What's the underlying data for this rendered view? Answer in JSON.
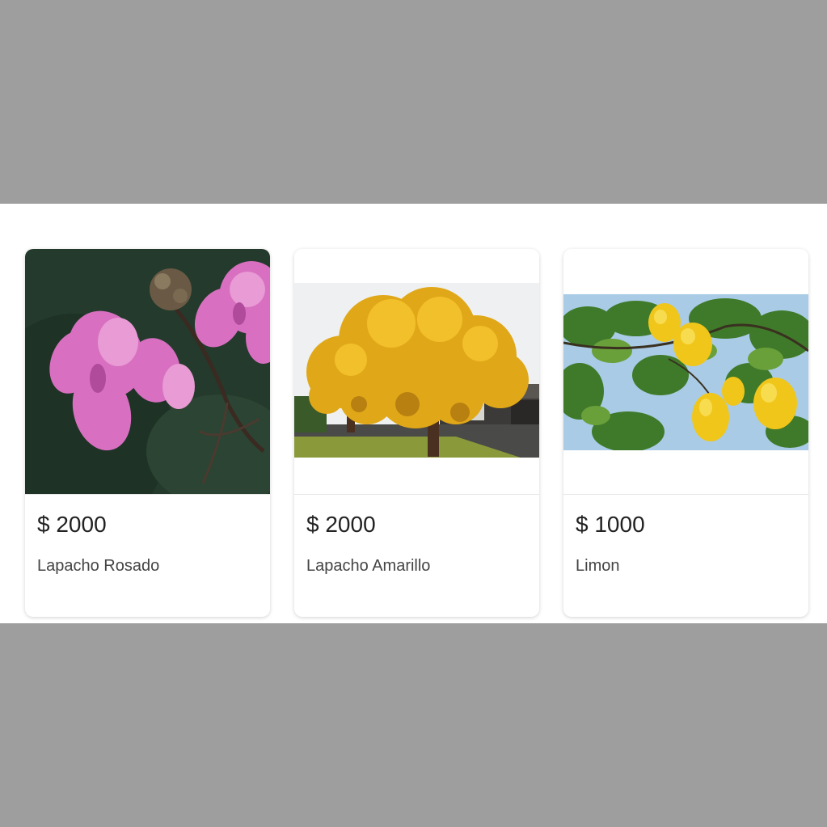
{
  "products": [
    {
      "price": "$ 2000",
      "name": "Lapacho Rosado",
      "image": "pink-flower-photo"
    },
    {
      "price": "$ 2000",
      "name": "Lapacho Amarillo",
      "image": "yellow-tree-photo"
    },
    {
      "price": "$ 1000",
      "name": "Limon",
      "image": "lemon-tree-photo"
    }
  ],
  "colors": {
    "page_bg": "#9e9e9e",
    "card_bg": "#ffffff",
    "price_text": "#222222",
    "name_text": "#444444"
  }
}
